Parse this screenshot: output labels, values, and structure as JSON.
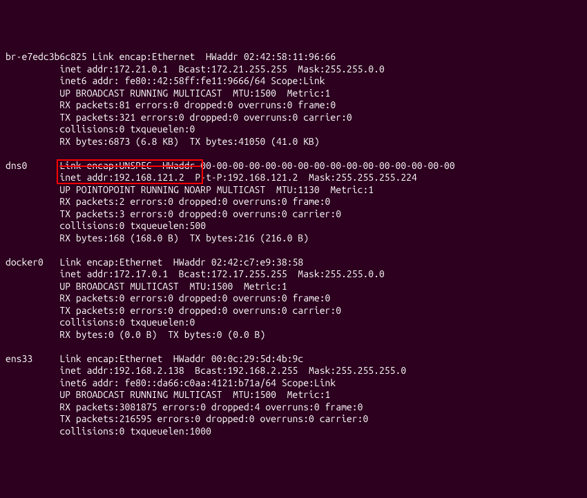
{
  "interfaces": [
    {
      "name": "br-e7edc3b6c825",
      "lines": [
        "br-e7edc3b6c825 Link encap:Ethernet  HWaddr 02:42:58:11:96:66",
        "          inet addr:172.21.0.1  Bcast:172.21.255.255  Mask:255.255.0.0",
        "          inet6 addr: fe80::42:58ff:fe11:9666/64 Scope:Link",
        "          UP BROADCAST RUNNING MULTICAST  MTU:1500  Metric:1",
        "          RX packets:81 errors:0 dropped:0 overruns:0 frame:0",
        "          TX packets:321 errors:0 dropped:0 overruns:0 carrier:0",
        "          collisions:0 txqueuelen:0",
        "          RX bytes:6873 (6.8 KB)  TX bytes:41050 (41.0 KB)"
      ]
    },
    {
      "name": "dns0",
      "prefix": "dns0      ",
      "strike_part": "Link encap:UNSPEC  HWaddr ",
      "after_strike": "00-00-00-00-00-00-00-00-00-00-00-00-00-00-00-00",
      "boxed_line_prefix": "          ",
      "boxed_part": "inet addr:192.168.121.2  P",
      "boxed_line_suffix": "-t-P:192.168.121.2  Mask:255.255.255.224",
      "rest": [
        "          UP POINTOPOINT RUNNING NOARP MULTICAST  MTU:1130  Metric:1",
        "          RX packets:2 errors:0 dropped:0 overruns:0 frame:0",
        "          TX packets:3 errors:0 dropped:0 overruns:0 carrier:0",
        "          collisions:0 txqueuelen:500",
        "          RX bytes:168 (168.0 B)  TX bytes:216 (216.0 B)"
      ]
    },
    {
      "name": "docker0",
      "lines": [
        "docker0   Link encap:Ethernet  HWaddr 02:42:c7:e9:38:58",
        "          inet addr:172.17.0.1  Bcast:172.17.255.255  Mask:255.255.0.0",
        "          UP BROADCAST MULTICAST  MTU:1500  Metric:1",
        "          RX packets:0 errors:0 dropped:0 overruns:0 frame:0",
        "          TX packets:0 errors:0 dropped:0 overruns:0 carrier:0",
        "          collisions:0 txqueuelen:0",
        "          RX bytes:0 (0.0 B)  TX bytes:0 (0.0 B)"
      ]
    },
    {
      "name": "ens33",
      "lines": [
        "ens33     Link encap:Ethernet  HWaddr 00:0c:29:5d:4b:9c",
        "          inet addr:192.168.2.138  Bcast:192.168.2.255  Mask:255.255.255.0",
        "          inet6 addr: fe80::da66:c0aa:4121:b71a/64 Scope:Link",
        "          UP BROADCAST RUNNING MULTICAST  MTU:1500  Metric:1",
        "          RX packets:3081875 errors:0 dropped:4 overruns:0 frame:0",
        "          TX packets:216595 errors:0 dropped:0 overruns:0 carrier:0",
        "          collisions:0 txqueuelen:1000"
      ]
    }
  ]
}
